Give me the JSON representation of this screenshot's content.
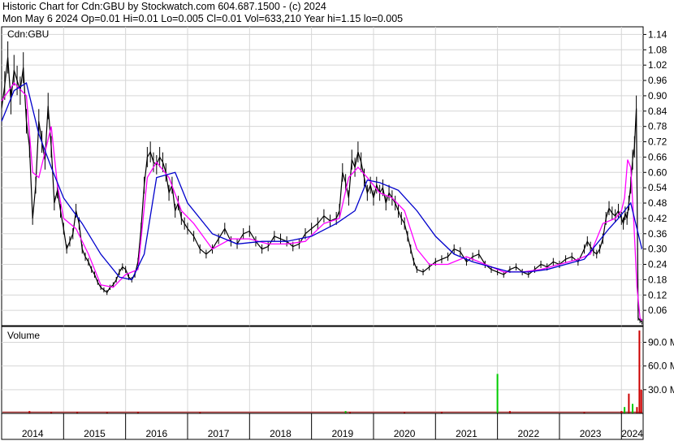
{
  "header": {
    "line1": "Historic Chart for Cdn:GBU by Stockwatch.com 604.687.1500 - (c) 2024",
    "line2": "Mon May  6 2024  Op=0.01  Hi=0.01  Lo=0.005  Cl=0.01  Vol=633,210  Year hi=1.15  lo=0.005"
  },
  "chart_data": [
    {
      "type": "line",
      "title": "Cdn:GBU",
      "x_unit": "year",
      "xlim": [
        2014.0,
        2024.35
      ],
      "ylim": [
        0.0,
        1.17
      ],
      "y_ticks": [
        "1.14",
        "1.08",
        "1.02",
        "0.96",
        "0.90",
        "0.84",
        "0.78",
        "0.72",
        "0.66",
        "0.60",
        "0.54",
        "0.48",
        "0.42",
        "0.36",
        "0.30",
        "0.24",
        "0.18",
        "0.12",
        "0.06"
      ],
      "x_tick_labels": [
        "2014",
        "2015",
        "2016",
        "2017",
        "2018",
        "2019",
        "2020",
        "2021",
        "2022",
        "2023",
        "2024"
      ],
      "grid": true,
      "series_colors": {
        "price": "#000000",
        "ma_short": "#ff00ff",
        "ma_long": "#0000cc"
      },
      "price": {
        "x": [
          2014.0,
          2014.05,
          2014.1,
          2014.15,
          2014.2,
          2014.25,
          2014.3,
          2014.35,
          2014.4,
          2014.45,
          2014.5,
          2014.55,
          2014.6,
          2014.65,
          2014.7,
          2014.75,
          2014.8,
          2014.85,
          2014.9,
          2014.95,
          2015.0,
          2015.05,
          2015.1,
          2015.15,
          2015.2,
          2015.25,
          2015.3,
          2015.35,
          2015.4,
          2015.45,
          2015.5,
          2015.55,
          2015.6,
          2015.65,
          2015.7,
          2015.75,
          2015.8,
          2015.85,
          2015.9,
          2015.95,
          2016.0,
          2016.05,
          2016.1,
          2016.15,
          2016.2,
          2016.25,
          2016.3,
          2016.35,
          2016.4,
          2016.45,
          2016.5,
          2016.55,
          2016.6,
          2016.65,
          2016.7,
          2016.75,
          2016.8,
          2016.85,
          2016.9,
          2016.95,
          2017.0,
          2017.1,
          2017.2,
          2017.3,
          2017.4,
          2017.5,
          2017.6,
          2017.7,
          2017.8,
          2017.9,
          2018.0,
          2018.1,
          2018.2,
          2018.3,
          2018.4,
          2018.5,
          2018.6,
          2018.7,
          2018.8,
          2018.9,
          2019.0,
          2019.1,
          2019.2,
          2019.3,
          2019.4,
          2019.45,
          2019.5,
          2019.55,
          2019.6,
          2019.65,
          2019.7,
          2019.75,
          2019.8,
          2019.85,
          2019.9,
          2019.95,
          2020.0,
          2020.05,
          2020.1,
          2020.15,
          2020.2,
          2020.25,
          2020.3,
          2020.35,
          2020.4,
          2020.45,
          2020.5,
          2020.55,
          2020.6,
          2020.65,
          2020.7,
          2020.8,
          2020.9,
          2021.0,
          2021.1,
          2021.2,
          2021.3,
          2021.4,
          2021.5,
          2021.6,
          2021.7,
          2021.8,
          2021.9,
          2022.0,
          2022.1,
          2022.2,
          2022.3,
          2022.4,
          2022.5,
          2022.6,
          2022.7,
          2022.8,
          2022.9,
          2023.0,
          2023.1,
          2023.2,
          2023.3,
          2023.4,
          2023.45,
          2023.5,
          2023.55,
          2023.6,
          2023.65,
          2023.7,
          2023.75,
          2023.8,
          2023.85,
          2023.9,
          2023.95,
          2024.0,
          2024.03,
          2024.06,
          2024.09,
          2024.12,
          2024.15,
          2024.18,
          2024.21,
          2024.24,
          2024.27,
          2024.3,
          2024.33
        ],
        "y": [
          0.85,
          0.94,
          1.05,
          0.88,
          1.0,
          0.96,
          0.92,
          1.01,
          0.8,
          0.7,
          0.42,
          0.55,
          0.8,
          0.72,
          0.65,
          0.86,
          0.7,
          0.48,
          0.53,
          0.45,
          0.38,
          0.3,
          0.33,
          0.36,
          0.45,
          0.4,
          0.3,
          0.27,
          0.25,
          0.22,
          0.2,
          0.17,
          0.15,
          0.14,
          0.13,
          0.15,
          0.16,
          0.18,
          0.21,
          0.23,
          0.22,
          0.19,
          0.18,
          0.2,
          0.25,
          0.38,
          0.55,
          0.66,
          0.68,
          0.64,
          0.63,
          0.66,
          0.64,
          0.6,
          0.52,
          0.55,
          0.45,
          0.48,
          0.42,
          0.4,
          0.38,
          0.35,
          0.3,
          0.28,
          0.3,
          0.34,
          0.38,
          0.33,
          0.32,
          0.36,
          0.37,
          0.33,
          0.3,
          0.31,
          0.35,
          0.34,
          0.33,
          0.31,
          0.32,
          0.36,
          0.38,
          0.4,
          0.43,
          0.41,
          0.42,
          0.45,
          0.6,
          0.56,
          0.5,
          0.65,
          0.62,
          0.68,
          0.64,
          0.58,
          0.52,
          0.55,
          0.5,
          0.55,
          0.52,
          0.54,
          0.48,
          0.52,
          0.5,
          0.48,
          0.45,
          0.42,
          0.4,
          0.35,
          0.3,
          0.25,
          0.22,
          0.21,
          0.23,
          0.25,
          0.26,
          0.27,
          0.3,
          0.29,
          0.25,
          0.27,
          0.28,
          0.24,
          0.22,
          0.21,
          0.2,
          0.22,
          0.23,
          0.21,
          0.2,
          0.22,
          0.24,
          0.23,
          0.25,
          0.24,
          0.26,
          0.27,
          0.25,
          0.3,
          0.33,
          0.31,
          0.29,
          0.28,
          0.3,
          0.34,
          0.42,
          0.46,
          0.44,
          0.43,
          0.45,
          0.42,
          0.4,
          0.44,
          0.42,
          0.48,
          0.55,
          0.65,
          0.7,
          0.85,
          0.03,
          0.02,
          0.015,
          0.01,
          0.008
        ]
      },
      "ma_short": {
        "x": [
          2014.0,
          2014.2,
          2014.4,
          2014.5,
          2014.6,
          2014.8,
          2014.9,
          2015.0,
          2015.2,
          2015.4,
          2015.6,
          2015.8,
          2016.0,
          2016.2,
          2016.35,
          2016.5,
          2016.7,
          2016.9,
          2017.1,
          2017.4,
          2017.7,
          2018.0,
          2018.3,
          2018.6,
          2018.9,
          2019.2,
          2019.45,
          2019.6,
          2019.75,
          2019.9,
          2020.1,
          2020.3,
          2020.5,
          2020.7,
          2020.9,
          2021.2,
          2021.5,
          2021.8,
          2022.1,
          2022.4,
          2022.7,
          2023.0,
          2023.3,
          2023.5,
          2023.7,
          2023.9,
          2024.0,
          2024.05,
          2024.1,
          2024.15,
          2024.2,
          2024.25,
          2024.3,
          2024.33
        ],
        "y": [
          0.88,
          0.95,
          0.9,
          0.6,
          0.58,
          0.78,
          0.55,
          0.42,
          0.38,
          0.28,
          0.16,
          0.15,
          0.2,
          0.22,
          0.58,
          0.64,
          0.58,
          0.45,
          0.4,
          0.3,
          0.34,
          0.34,
          0.32,
          0.32,
          0.33,
          0.4,
          0.42,
          0.58,
          0.62,
          0.58,
          0.52,
          0.5,
          0.45,
          0.3,
          0.24,
          0.24,
          0.27,
          0.24,
          0.21,
          0.21,
          0.22,
          0.24,
          0.26,
          0.28,
          0.4,
          0.42,
          0.45,
          0.5,
          0.65,
          0.62,
          0.4,
          0.15,
          0.03,
          0.02
        ]
      },
      "ma_long": {
        "x": [
          2014.0,
          2014.2,
          2014.4,
          2014.6,
          2014.8,
          2015.0,
          2015.3,
          2015.6,
          2015.9,
          2016.1,
          2016.3,
          2016.5,
          2016.8,
          2017.0,
          2017.4,
          2017.8,
          2018.2,
          2018.6,
          2019.0,
          2019.4,
          2019.7,
          2019.9,
          2020.1,
          2020.4,
          2020.7,
          2021.0,
          2021.3,
          2021.6,
          2021.9,
          2022.2,
          2022.5,
          2022.8,
          2023.1,
          2023.4,
          2023.6,
          2023.8,
          2023.95,
          2024.05,
          2024.15,
          2024.25,
          2024.33
        ],
        "y": [
          0.8,
          0.92,
          0.95,
          0.75,
          0.62,
          0.5,
          0.4,
          0.28,
          0.19,
          0.18,
          0.28,
          0.58,
          0.6,
          0.48,
          0.36,
          0.32,
          0.33,
          0.33,
          0.35,
          0.4,
          0.45,
          0.57,
          0.56,
          0.53,
          0.45,
          0.35,
          0.28,
          0.25,
          0.23,
          0.21,
          0.21,
          0.22,
          0.24,
          0.26,
          0.32,
          0.38,
          0.42,
          0.45,
          0.48,
          0.38,
          0.3
        ]
      }
    },
    {
      "type": "bar",
      "title": "Volume",
      "x_unit": "year",
      "xlim": [
        2014.0,
        2024.35
      ],
      "ylim": [
        0,
        110
      ],
      "y_ticks": [
        "90.0 M",
        "60.0 M",
        "30.0 M"
      ],
      "bar_colors": {
        "up": "#00cc00",
        "down": "#cc0000"
      },
      "bars": [
        {
          "x": 2014.45,
          "value": 3,
          "dir": "down"
        },
        {
          "x": 2014.8,
          "value": 2,
          "dir": "down"
        },
        {
          "x": 2015.22,
          "value": 2,
          "dir": "down"
        },
        {
          "x": 2015.7,
          "value": 1.5,
          "dir": "down"
        },
        {
          "x": 2016.2,
          "value": 2,
          "dir": "down"
        },
        {
          "x": 2017.2,
          "value": 1.5,
          "dir": "down"
        },
        {
          "x": 2019.55,
          "value": 3,
          "dir": "up"
        },
        {
          "x": 2019.62,
          "value": 2,
          "dir": "down"
        },
        {
          "x": 2020.5,
          "value": 1.5,
          "dir": "down"
        },
        {
          "x": 2021.1,
          "value": 2,
          "dir": "down"
        },
        {
          "x": 2022.0,
          "value": 50,
          "dir": "up"
        },
        {
          "x": 2022.2,
          "value": 3,
          "dir": "down"
        },
        {
          "x": 2023.4,
          "value": 1.5,
          "dir": "down"
        },
        {
          "x": 2024.0,
          "value": 3,
          "dir": "down"
        },
        {
          "x": 2024.05,
          "value": 8,
          "dir": "up"
        },
        {
          "x": 2024.12,
          "value": 25,
          "dir": "down"
        },
        {
          "x": 2024.18,
          "value": 12,
          "dir": "up"
        },
        {
          "x": 2024.25,
          "value": 8,
          "dir": "down"
        },
        {
          "x": 2024.29,
          "value": 105,
          "dir": "down"
        },
        {
          "x": 2024.32,
          "value": 30,
          "dir": "down"
        }
      ]
    }
  ]
}
